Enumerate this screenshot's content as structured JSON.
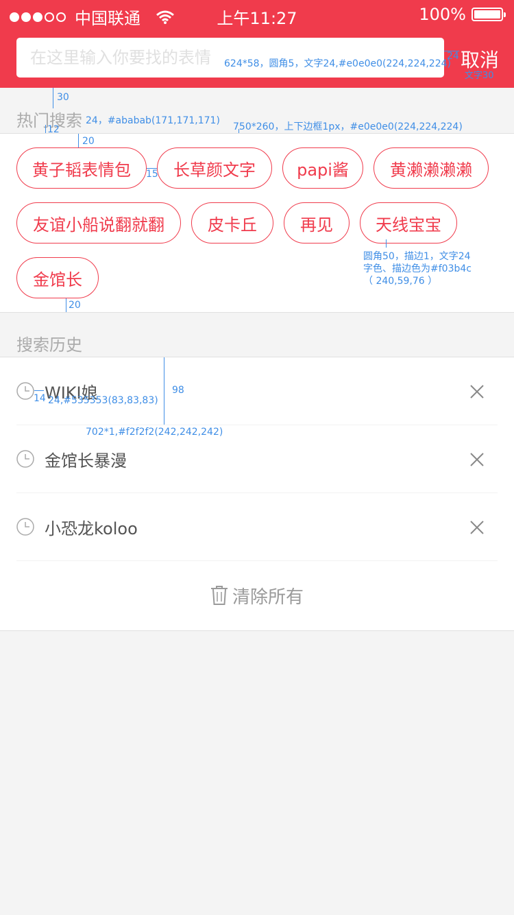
{
  "status_bar": {
    "carrier": "中国联通",
    "time": "上午11:27",
    "battery": "100%",
    "signal_bars_filled": 3,
    "signal_bars_total": 5
  },
  "search": {
    "placeholder": "在这里输入你要找的表情",
    "value": "",
    "cancel_label": "取消"
  },
  "hot": {
    "title": "热门搜索",
    "tags": [
      {
        "label": "黄子韬表情包"
      },
      {
        "label": "长草颜文字"
      },
      {
        "label": "papi酱"
      },
      {
        "label": "黄濑濑濑濑"
      },
      {
        "label": "友谊小船说翻就翻"
      },
      {
        "label": "皮卡丘"
      },
      {
        "label": "再见"
      },
      {
        "label": "天线宝宝"
      },
      {
        "label": "金馆长"
      }
    ]
  },
  "history": {
    "title": "搜索历史",
    "items": [
      {
        "label": "WIKI娘"
      },
      {
        "label": "金馆长暴漫"
      },
      {
        "label": "小恐龙koloo"
      }
    ],
    "clear_label": "清除所有"
  },
  "annotations": {
    "search_spec": "624*58，圆角5，文字24,#e0e0e0(224,224,224)",
    "cancel_gap": "24",
    "cancel_spec": "文字30",
    "top_gap": "30",
    "title_spec": "24，#ababab(171,171,171)",
    "title_gap": "12",
    "panel_spec": "750*260，上下边框1px，#e0e0e0(224,224,224)",
    "tag_top_gap": "20",
    "tag_h_gap": "15",
    "tag_spec_1": "圆角50，描边1，文字24",
    "tag_spec_2": "字色、描边色为#f03b4c",
    "tag_spec_3": "（ 240,59,76 ）",
    "tag_bottom_gap": "20",
    "row_height": "98",
    "icon_gap": "14",
    "history_text_spec": "24,#535353(83,83,83)",
    "divider_spec": "702*1,#f2f2f2(242,242,242)"
  },
  "colors": {
    "accent": "#f03b4c",
    "placeholder": "#e0e0e0",
    "section_title": "#ababab",
    "history_text": "#535353",
    "divider": "#f2f2f2",
    "annotation": "#3f8ee6"
  }
}
